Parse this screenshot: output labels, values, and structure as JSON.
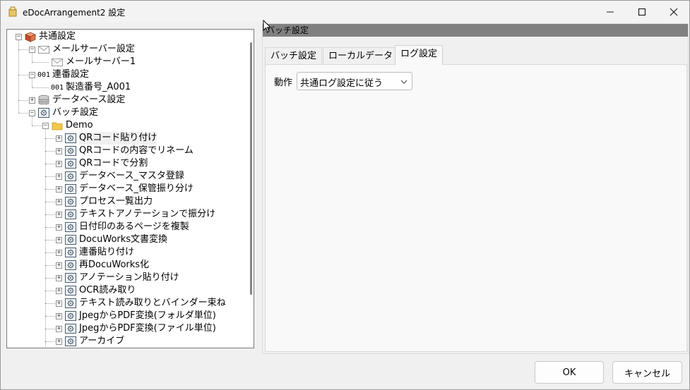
{
  "window": {
    "title": "eDocArrangement2 設定",
    "controls": {
      "minimize": "minimize-icon",
      "maximize": "maximize-icon",
      "close": "close-icon"
    }
  },
  "tree": {
    "nodes": [
      {
        "label": "共通設定",
        "level": 0,
        "expander": "-",
        "icon": "package-icon"
      },
      {
        "label": "メールサーバー設定",
        "level": 1,
        "expander": "-",
        "icon": "envelope-icon"
      },
      {
        "label": "メールサーバー1",
        "level": 2,
        "expander": "",
        "icon": "envelope-icon"
      },
      {
        "label": "連番設定",
        "level": 1,
        "expander": "-",
        "icon": "number-icon",
        "icon_text": "001"
      },
      {
        "label": "製造番号_A001",
        "level": 2,
        "expander": "",
        "icon": "number-icon",
        "icon_text": "001"
      },
      {
        "label": "データベース設定",
        "level": 1,
        "expander": "+",
        "icon": "database-icon"
      },
      {
        "label": "バッチ設定",
        "level": 1,
        "expander": "-",
        "icon": "batch-gear-icon"
      },
      {
        "label": "Demo",
        "level": 2,
        "expander": "-",
        "icon": "folder-icon"
      },
      {
        "label": "QRコード貼り付け",
        "level": 3,
        "expander": "+",
        "icon": "batch-gear-icon",
        "selected": true
      },
      {
        "label": "QRコードの内容でリネーム",
        "level": 3,
        "expander": "+",
        "icon": "batch-gear-icon"
      },
      {
        "label": "QRコードで分割",
        "level": 3,
        "expander": "+",
        "icon": "batch-gear-icon"
      },
      {
        "label": "データベース_マスタ登録",
        "level": 3,
        "expander": "+",
        "icon": "batch-gear-icon"
      },
      {
        "label": "データベース_保管振り分け",
        "level": 3,
        "expander": "+",
        "icon": "batch-gear-icon"
      },
      {
        "label": "プロセス一覧出力",
        "level": 3,
        "expander": "+",
        "icon": "batch-gear-icon"
      },
      {
        "label": "テキストアノテーションで振分け",
        "level": 3,
        "expander": "+",
        "icon": "batch-gear-icon"
      },
      {
        "label": "日付印のあるページを複製",
        "level": 3,
        "expander": "+",
        "icon": "batch-gear-icon"
      },
      {
        "label": "DocuWorks文書変換",
        "level": 3,
        "expander": "+",
        "icon": "batch-gear-icon"
      },
      {
        "label": "連番貼り付け",
        "level": 3,
        "expander": "+",
        "icon": "batch-gear-icon"
      },
      {
        "label": "再DocuWorks化",
        "level": 3,
        "expander": "+",
        "icon": "batch-gear-icon"
      },
      {
        "label": "アノテーション貼り付け",
        "level": 3,
        "expander": "+",
        "icon": "batch-gear-icon"
      },
      {
        "label": "OCR読み取り",
        "level": 3,
        "expander": "+",
        "icon": "batch-gear-icon"
      },
      {
        "label": "テキスト読み取りとバインダー束ね",
        "level": 3,
        "expander": "+",
        "icon": "batch-gear-icon"
      },
      {
        "label": "JpegからPDF変換(フォルダ単位)",
        "level": 3,
        "expander": "+",
        "icon": "batch-gear-icon"
      },
      {
        "label": "JpegからPDF変換(ファイル単位)",
        "level": 3,
        "expander": "+",
        "icon": "batch-gear-icon"
      },
      {
        "label": "アーカイブ",
        "level": 3,
        "expander": "+",
        "icon": "batch-gear-icon"
      }
    ]
  },
  "right": {
    "section_title": "バッチ設定",
    "tabs": [
      {
        "label": "バッチ設定",
        "active": false
      },
      {
        "label": "ローカルデータ",
        "active": false
      },
      {
        "label": "ログ設定",
        "active": true
      }
    ],
    "log": {
      "action_label": "動作",
      "action_value": "共通ログ設定に従う"
    }
  },
  "footer": {
    "ok_label": "OK",
    "cancel_label": "キャンセル"
  },
  "colors": {
    "section_bar": "#808080",
    "tree_background": "#ffffff",
    "window_background": "#f0f0f0"
  }
}
